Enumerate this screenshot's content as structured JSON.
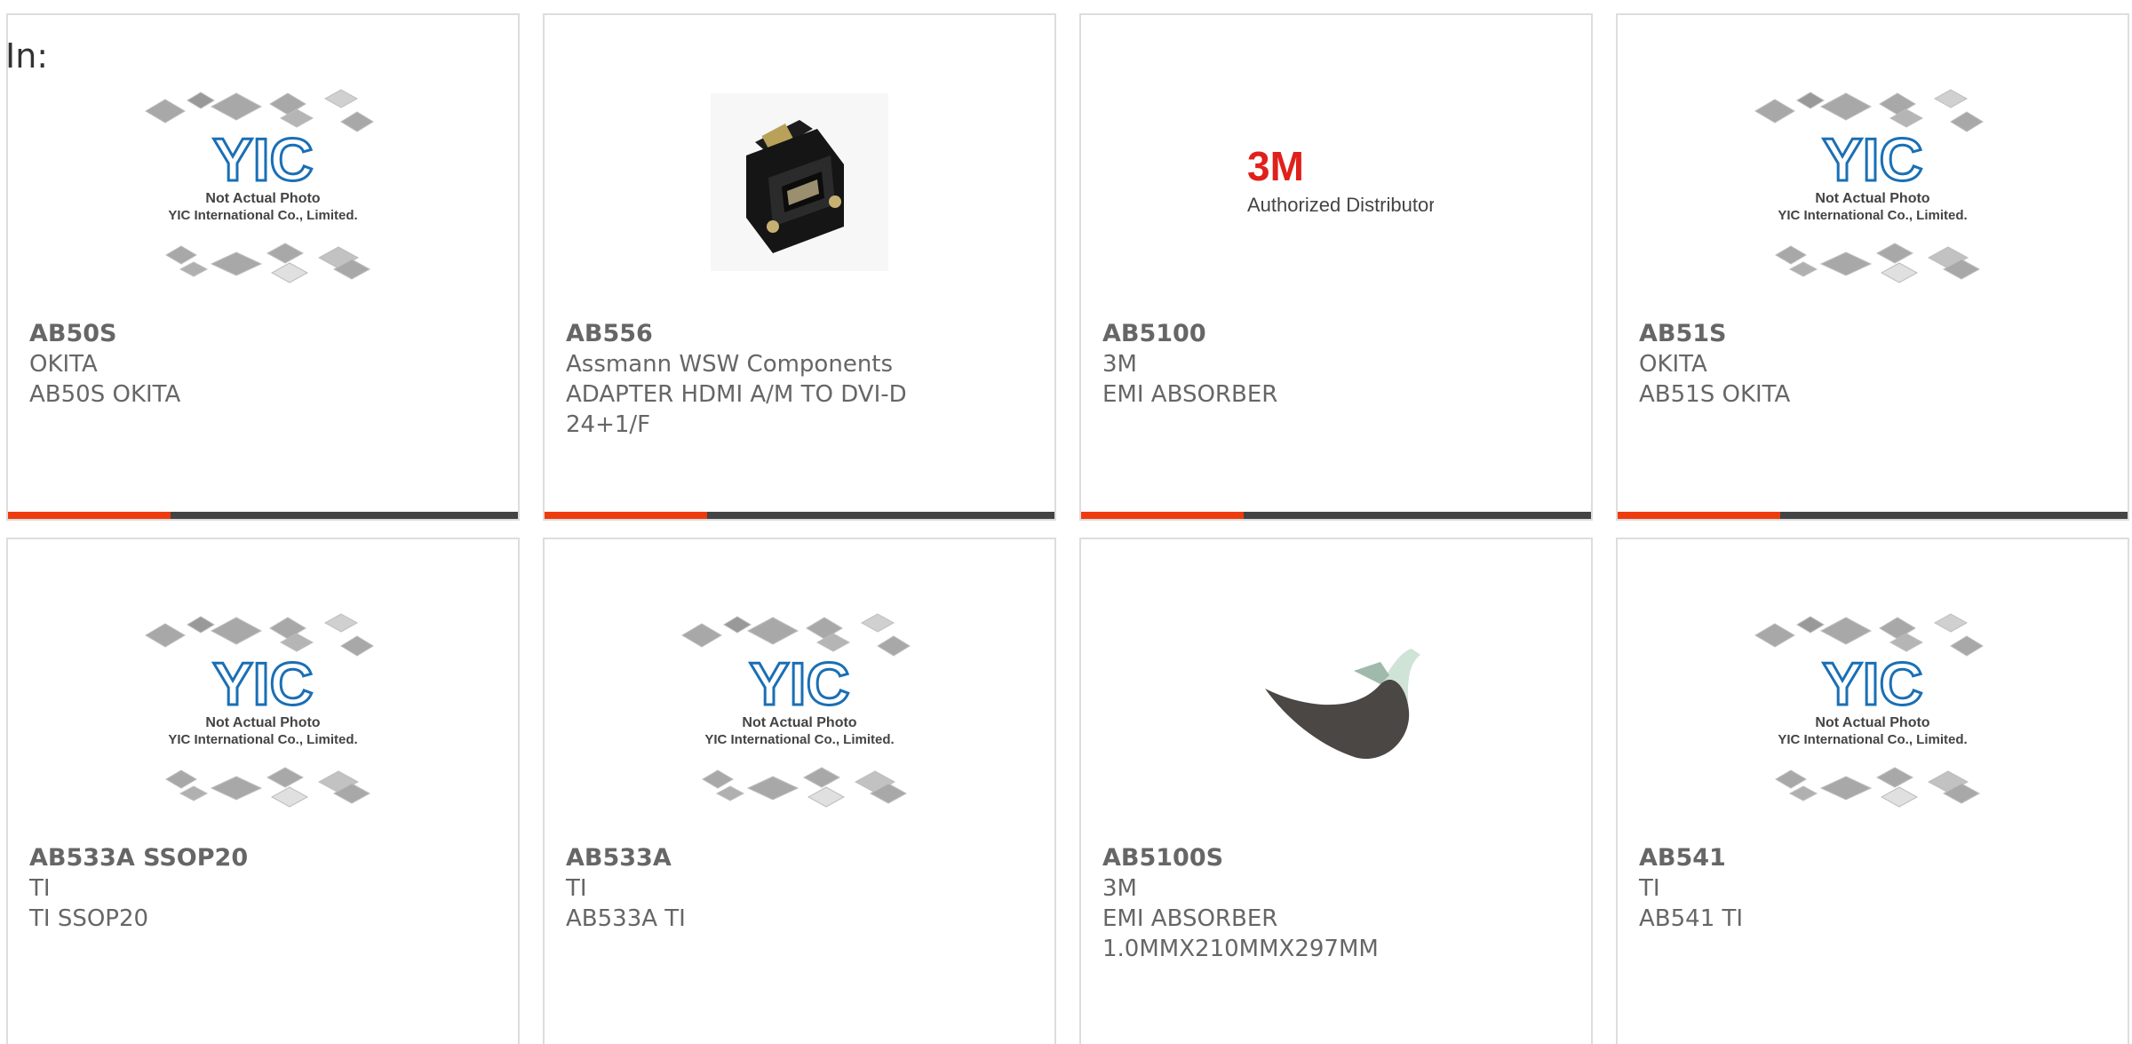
{
  "filter": {
    "label": "In:"
  },
  "colors": {
    "accent": "#ee3b0e",
    "bar": "#444444",
    "text": "#666666",
    "yic_logo": "#1a6fb5"
  },
  "placeholder": {
    "line1": "Not Actual Photo",
    "line2": "YIC International Co., Limited.",
    "logo": "YIC"
  },
  "products": [
    {
      "part_number": "AB50S",
      "manufacturer": "OKITA",
      "description": "AB50S OKITA",
      "image": "yic-placeholder"
    },
    {
      "part_number": "AB556",
      "manufacturer": "Assmann WSW Components",
      "description": "ADAPTER HDMI A/M TO DVI-D 24+1/F",
      "image": "hdmi-dvi-adapter-photo"
    },
    {
      "part_number": "AB5100",
      "manufacturer": "3M",
      "description": "EMI ABSORBER",
      "image": "3m-logo",
      "logo_brand": "3M",
      "logo_caption": "Authorized Distributor"
    },
    {
      "part_number": "AB51S",
      "manufacturer": "OKITA",
      "description": "AB51S OKITA",
      "image": "yic-placeholder"
    },
    {
      "part_number": "AB533A SSOP20",
      "manufacturer": "TI",
      "description": "TI SSOP20",
      "image": "yic-placeholder"
    },
    {
      "part_number": "AB533A",
      "manufacturer": "TI",
      "description": "AB533A TI",
      "image": "yic-placeholder"
    },
    {
      "part_number": "AB5100S",
      "manufacturer": "3M",
      "description": "EMI ABSORBER 1.0MMX210MMX297MM",
      "image": "emi-absorber-sheet-photo"
    },
    {
      "part_number": "AB541",
      "manufacturer": "TI",
      "description": "AB541 TI",
      "image": "yic-placeholder"
    }
  ]
}
